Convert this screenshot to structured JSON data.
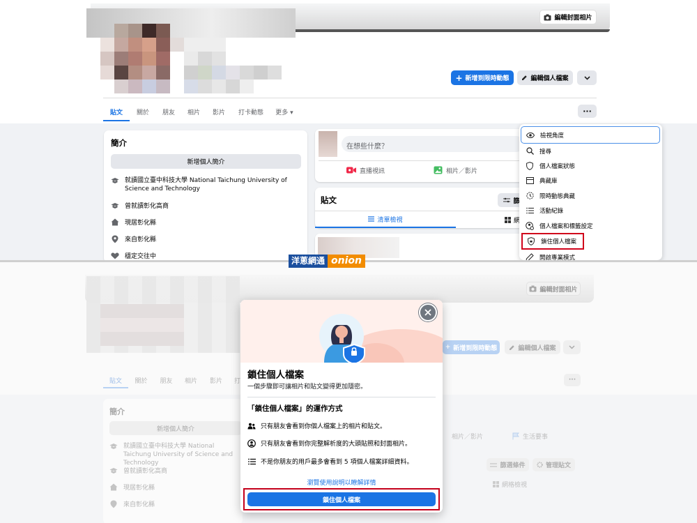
{
  "top": {
    "cover_button": "編輯封面相片",
    "add_story": "新增到限時動態",
    "edit_profile": "編輯個人檔案",
    "tabs": [
      "貼文",
      "關於",
      "朋友",
      "相片",
      "影片",
      "打卡動態",
      "更多"
    ],
    "intro": {
      "title": "簡介",
      "add_bio": "新增個人簡介",
      "items": [
        "就讀國立臺中科技大學 National Taichung University of Science and Technology",
        "曾就讀彰化高商",
        "現居彰化縣",
        "來自彰化縣",
        "穩定交往中"
      ]
    },
    "composer": {
      "placeholder": "在想些什麼？",
      "live": "直播視訊",
      "photo": "相片／影片"
    },
    "posts": {
      "title": "貼文",
      "filter": "篩",
      "list_view": "清單檢視",
      "grid": "網"
    },
    "menu": [
      "檢視角度",
      "搜尋",
      "個人檔案狀態",
      "典藏庫",
      "限時動態典藏",
      "活動紀錄",
      "個人檔案和標籤設定",
      "鎖住個人檔案",
      "開啟專業模式"
    ]
  },
  "watermark": {
    "cn": "洋蔥網通",
    "en": "onion"
  },
  "bottom": {
    "cover_button": "編輯封面相片",
    "add_story": "新增到限時動態",
    "edit_profile": "編輯個人檔案",
    "tabs": [
      "貼文",
      "關於",
      "朋友",
      "相片",
      "影片",
      "打卡動態"
    ],
    "intro_title": "簡介",
    "add_bio": "新增個人簡介",
    "intro_items": [
      "就讀國立臺中科技大學 National Taichung University of Science and Technology",
      "曾就讀彰化高商",
      "現居彰化縣",
      "來自彰化縣"
    ],
    "photo": "相片／影片",
    "life_event": "生活要事",
    "filter_btn": "篩選條件",
    "manage_btn": "管理貼文",
    "grid_view": "網格檢視"
  },
  "dialog": {
    "title": "鎖住個人檔案",
    "subtitle": "一個步驟即可讓相片和貼文變得更加隱密。",
    "how_title": "「鎖住個人檔案」的運作方式",
    "points": [
      "只有朋友會看到你個人檔案上的相片和貼文。",
      "只有朋友會看到你完整解析度的大頭貼照和封面相片。",
      "不是你朋友的用戶最多會看到 5 項個人檔案詳細資料。"
    ],
    "help_link": "瀏覽使用說明以瞭解詳情",
    "lock_button": "鎖住個人檔案"
  },
  "colors": {
    "accent": "#1b74e4",
    "highlight": "#d0021b",
    "page_bg": "#f0f2f5"
  }
}
